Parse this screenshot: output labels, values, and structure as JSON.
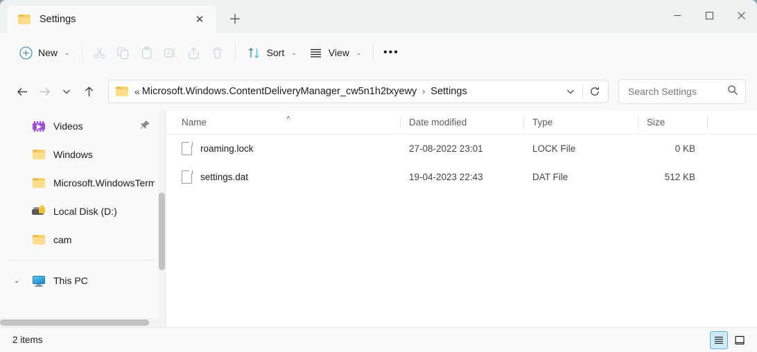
{
  "window": {
    "tab_title": "Settings",
    "tab_close_glyph": "✕",
    "new_tab_glyph": "＋",
    "minimize_label": "Minimize",
    "maximize_label": "Maximize",
    "close_label": "Close"
  },
  "toolbar": {
    "new_label": "New",
    "new_chevron": "⌄",
    "cut_label": "Cut",
    "copy_label": "Copy",
    "paste_label": "Paste",
    "rename_label": "Rename",
    "share_label": "Share",
    "delete_label": "Delete",
    "sort_label": "Sort",
    "sort_chevron": "⌄",
    "view_label": "View",
    "view_chevron": "⌄",
    "more_glyph": "•••"
  },
  "address": {
    "back_label": "Back",
    "forward_label": "Forward",
    "recent_chevron": "⌄",
    "up_label": "Up",
    "overflow_glyph": "«",
    "crumb_parent": "Microsoft.Windows.ContentDeliveryManager_cw5n1h2txyewy",
    "crumb_arrow": "›",
    "crumb_current": "Settings",
    "dropdown_chevron": "⌄",
    "refresh_label": "Refresh"
  },
  "search": {
    "placeholder": "Search Settings",
    "value": ""
  },
  "sidebar": {
    "items": [
      {
        "label": "Videos",
        "icon": "videos-icon",
        "pinned": true
      },
      {
        "label": "Windows",
        "icon": "folder-icon",
        "pinned": false
      },
      {
        "label": "Microsoft.WindowsTermi",
        "icon": "folder-icon",
        "pinned": false
      },
      {
        "label": "Local Disk (D:)",
        "icon": "locked-disk-icon",
        "pinned": false
      },
      {
        "label": "cam",
        "icon": "folder-icon",
        "pinned": false
      }
    ],
    "this_pc": {
      "label": "This PC",
      "icon": "this-pc-icon",
      "chevron": "⌄"
    }
  },
  "filelist": {
    "columns": [
      {
        "key": "name",
        "label": "Name"
      },
      {
        "key": "date",
        "label": "Date modified"
      },
      {
        "key": "type",
        "label": "Type"
      },
      {
        "key": "size",
        "label": "Size"
      }
    ],
    "sort_column": "Name",
    "sort_caret": "˄",
    "rows": [
      {
        "name": "roaming.lock",
        "date": "27-08-2022 23:01",
        "type": "LOCK File",
        "size": "0 KB"
      },
      {
        "name": "settings.dat",
        "date": "19-04-2023 22:43",
        "type": "DAT File",
        "size": "512 KB"
      }
    ]
  },
  "statusbar": {
    "item_count": "2 items",
    "details_view_label": "Details view",
    "large_icons_view_label": "Large icons view"
  },
  "colors": {
    "accent": "#0f6cbd",
    "window_bg": "#f9f9f9",
    "content_bg": "#ffffff",
    "desktop_bg": "#8aa6ab",
    "disabled": "#c8d4dc",
    "selected_view": "#cfe9f7"
  }
}
